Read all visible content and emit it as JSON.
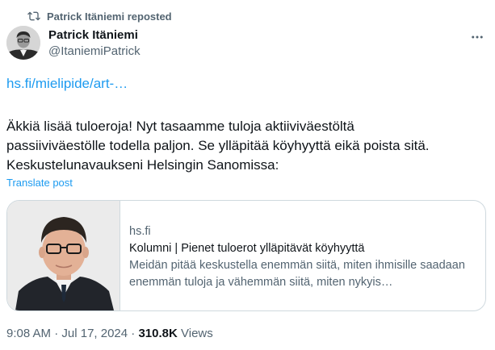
{
  "repost": {
    "text": "Patrick Itäniemi reposted",
    "icon": "repost-icon"
  },
  "author": {
    "name": "Patrick Itäniemi",
    "handle": "@ItaniemiPatrick"
  },
  "post": {
    "link": "hs.fi/mielipide/art-…",
    "lines": [
      "Äkkiä lisää tuloeroja! Nyt tasaamme tuloja aktiiviväestöltä",
      "passiiviväestölle todella paljon. Se ylläpitää köyhyyttä eikä poista sitä.",
      "Keskustelunavaukseni Helsingin Sanomissa:"
    ],
    "translate": "Translate post"
  },
  "card": {
    "domain": "hs.fi",
    "title": "Kolumni | Pienet tuloerot ylläpitävät köyhyyttä",
    "description": "Meidän pitää keskustella enemmän siitä, miten ihmisille saadaan enemmän tuloja ja vähemmän siitä, miten nykyis…"
  },
  "meta": {
    "time": "9:08 AM",
    "separator1": " · ",
    "date": "Jul 17, 2024",
    "separator2": " · ",
    "views_count": "310.8K",
    "views_label": " Views"
  },
  "colors": {
    "accent": "#1d9bf0",
    "secondary_text": "#536471",
    "primary_text": "#0f1419",
    "border": "#cfd9de"
  }
}
